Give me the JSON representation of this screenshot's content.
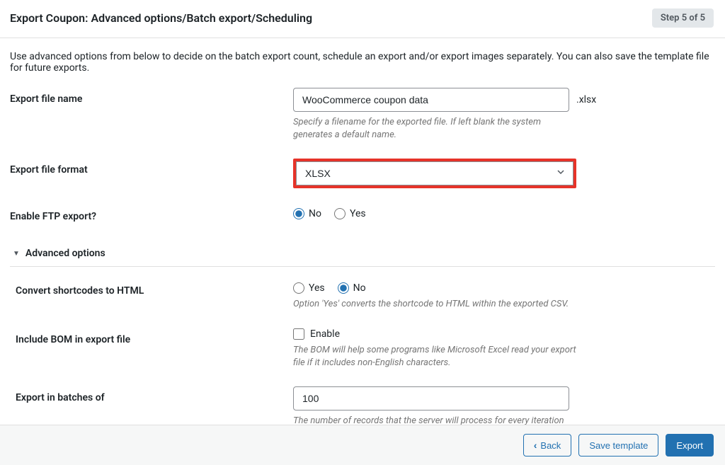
{
  "header": {
    "title": "Export Coupon: Advanced options/Batch export/Scheduling",
    "step_badge": "Step 5 of 5"
  },
  "description": "Use advanced options from below to decide on the batch export count, schedule an export and/or export images separately. You can also save the template file for future exports.",
  "filename": {
    "label": "Export file name",
    "value": "WooCommerce coupon data",
    "extension": ".xlsx",
    "help": "Specify a filename for the exported file. If left blank the system generates a default name."
  },
  "fileformat": {
    "label": "Export file format",
    "value": "XLSX"
  },
  "ftp": {
    "label": "Enable FTP export?",
    "no": "No",
    "yes": "Yes"
  },
  "advanced": {
    "title": "Advanced options",
    "shortcodes": {
      "label": "Convert shortcodes to HTML",
      "yes": "Yes",
      "no": "No",
      "help": "Option 'Yes' converts the shortcode to HTML within the exported CSV."
    },
    "bom": {
      "label": "Include BOM in export file",
      "enable": "Enable",
      "help": "The BOM will help some programs like Microsoft Excel read your export file if it includes non-English characters."
    },
    "batch": {
      "label": "Export in batches of",
      "value": "100",
      "help": "The number of records that the server will process for every iteration within the configured timeout interval. If the export fails due to timeout you can lower this number accordingly and try again"
    }
  },
  "footer": {
    "back": "Back",
    "save": "Save template",
    "export": "Export"
  }
}
